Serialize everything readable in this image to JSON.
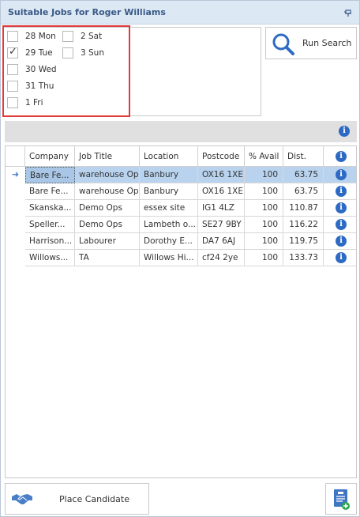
{
  "window": {
    "title": "Suitable Jobs for Roger Williams"
  },
  "days": [
    {
      "label": "28 Mon",
      "checked": false
    },
    {
      "label": "29 Tue",
      "checked": true
    },
    {
      "label": "30 Wed",
      "checked": false
    },
    {
      "label": "31 Thu",
      "checked": false
    },
    {
      "label": "1 Fri",
      "checked": false
    },
    {
      "label": "2 Sat",
      "checked": false
    },
    {
      "label": "3 Sun",
      "checked": false
    }
  ],
  "run_search": {
    "label": "Run Search"
  },
  "grid": {
    "columns": [
      "Company",
      "Job Title",
      "Location",
      "Postcode",
      "% Avail",
      "Dist."
    ],
    "rows": [
      {
        "company": "Bare Fe...",
        "job_title": "warehouse Op",
        "location": "Banbury",
        "postcode": "OX16 1XE",
        "avail": "100",
        "dist": "63.75",
        "selected": true
      },
      {
        "company": "Bare Fe...",
        "job_title": "warehouse Op",
        "location": "Banbury",
        "postcode": "OX16 1XE",
        "avail": "100",
        "dist": "63.75",
        "selected": false
      },
      {
        "company": "Skanska...",
        "job_title": "Demo Ops",
        "location": "essex site",
        "postcode": "IG1 4LZ",
        "avail": "100",
        "dist": "110.87",
        "selected": false
      },
      {
        "company": "Speller...",
        "job_title": "Demo Ops",
        "location": "Lambeth o...",
        "postcode": "SE27 9BY",
        "avail": "100",
        "dist": "116.22",
        "selected": false
      },
      {
        "company": "Harrison...",
        "job_title": "Labourer",
        "location": "Dorothy E...",
        "postcode": "DA7 6AJ",
        "avail": "100",
        "dist": "119.75",
        "selected": false
      },
      {
        "company": "Willows...",
        "job_title": "TA",
        "location": "Willows Hi...",
        "postcode": "cf24 2ye",
        "avail": "100",
        "dist": "133.73",
        "selected": false
      }
    ]
  },
  "place_candidate": {
    "label": "Place Candidate"
  },
  "icons": {
    "pin": "pin-icon",
    "search": "search-icon",
    "info": "info-icon",
    "handshake": "handshake-icon",
    "document_add": "document-add-icon"
  },
  "colors": {
    "title_bg": "#dde8f5",
    "title_text": "#3a5a86",
    "highlight": "#e03c3c",
    "selection": "#b9d3ef",
    "info_blue": "#2d6ac4"
  }
}
